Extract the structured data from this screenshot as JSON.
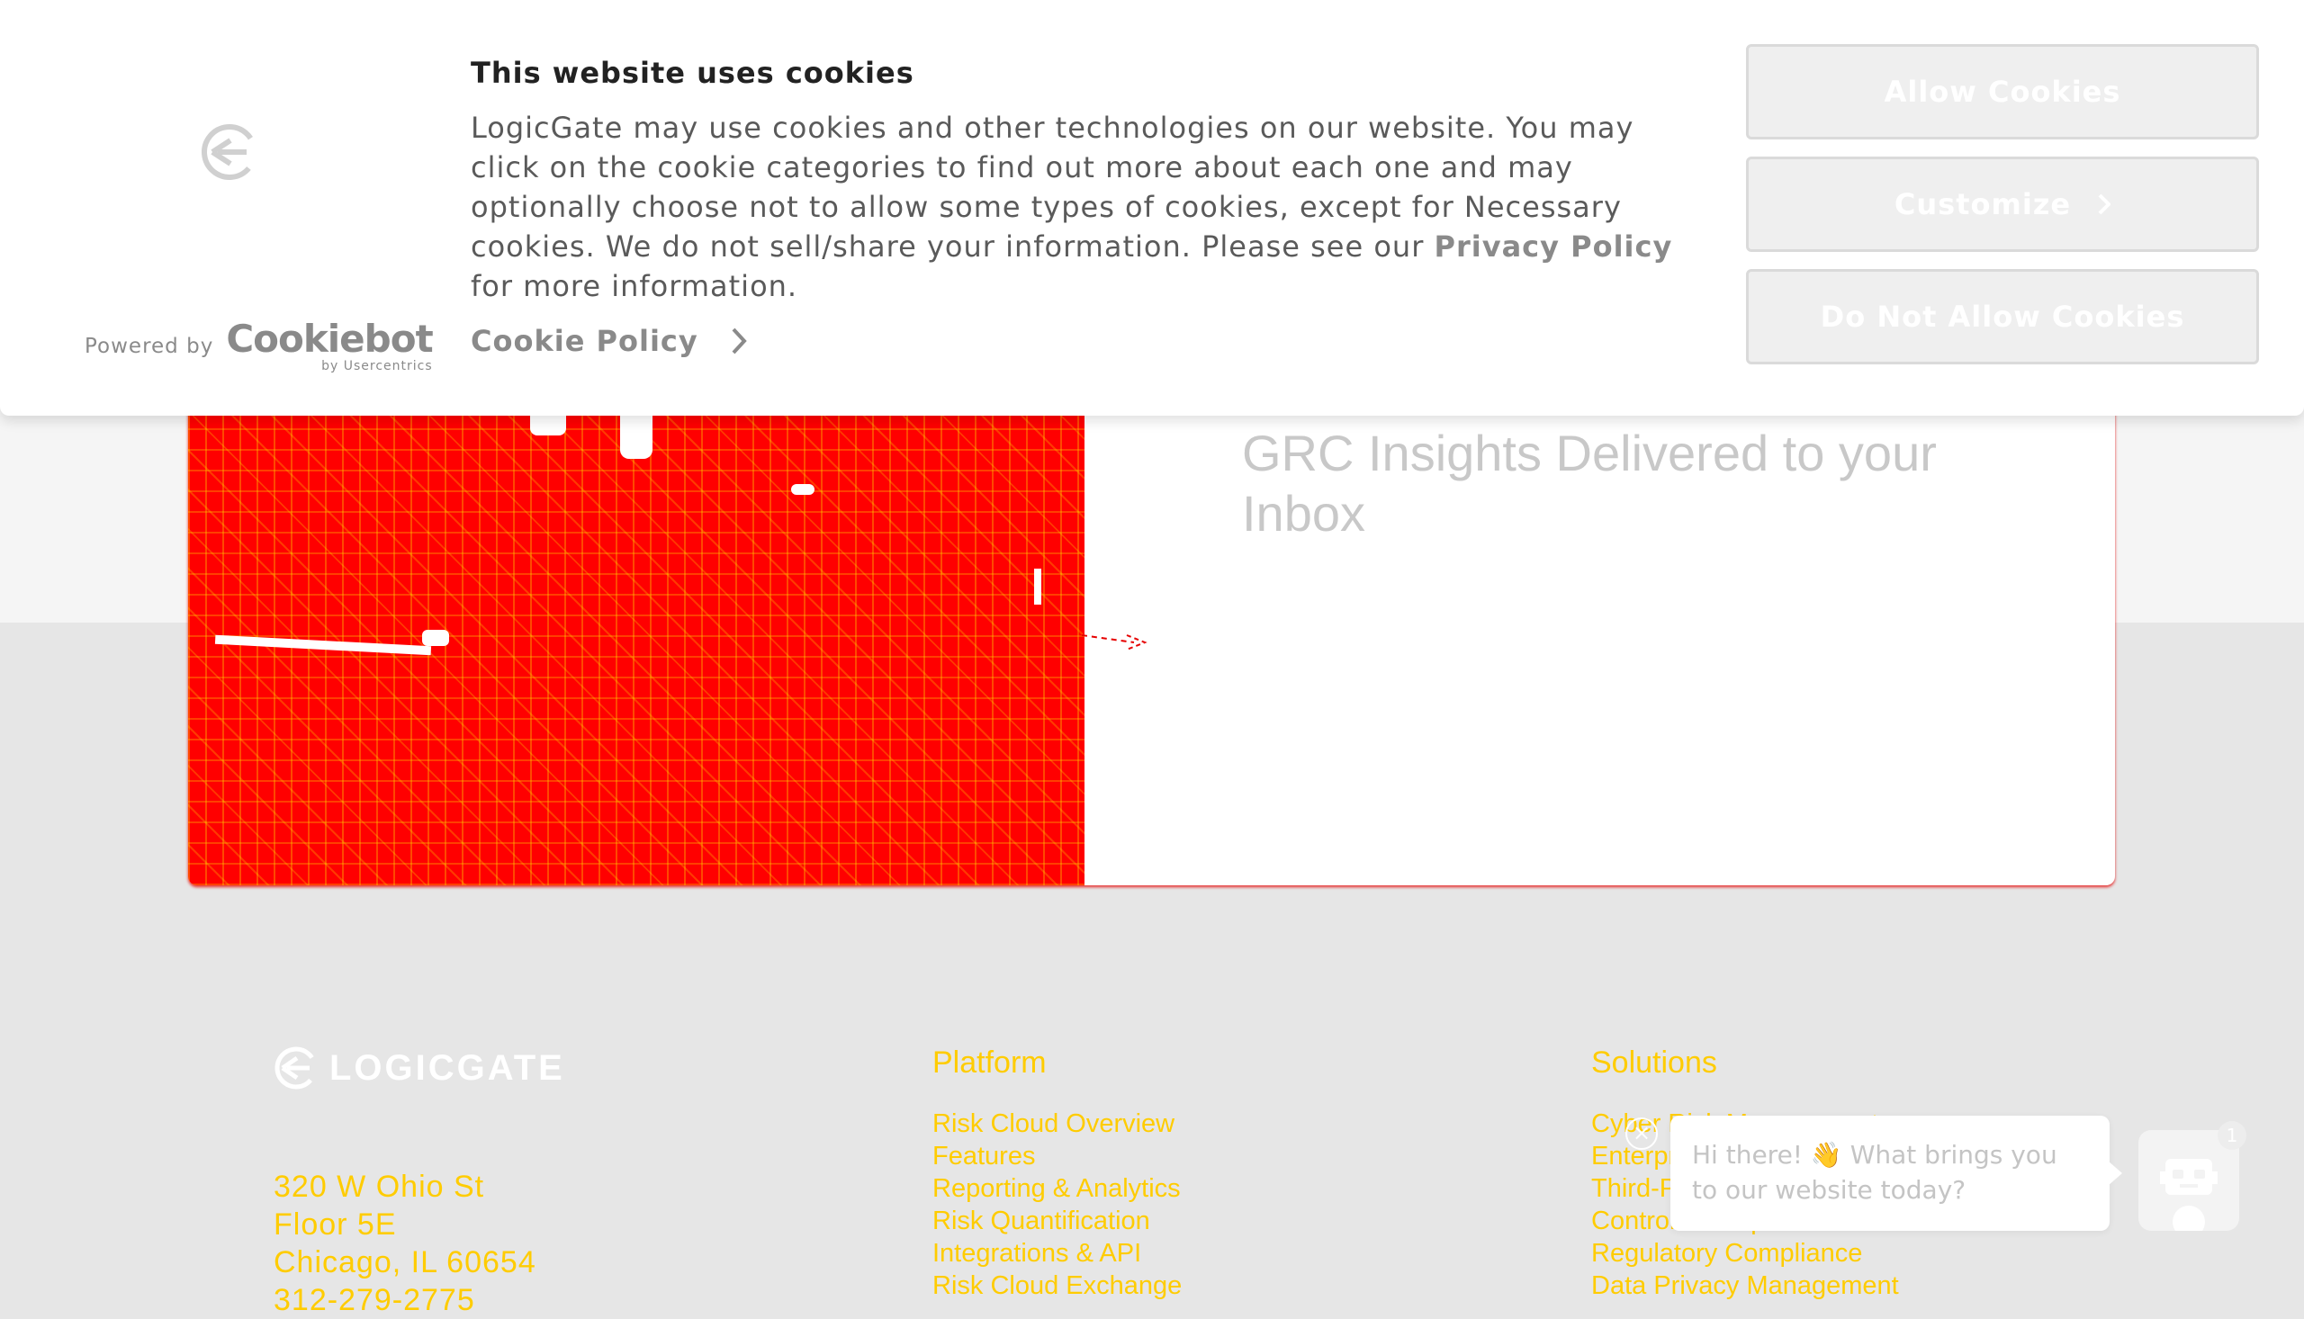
{
  "cookie_banner": {
    "heading": "This website uses cookies",
    "body_pre": "LogicGate may use cookies and other technologies on our website. You may click on the cookie categories to find out more about each one and may optionally choose not to allow some types of cookies, except for Necessary cookies.  We do not sell/share your information. Please see our ",
    "privacy_link": "Privacy Policy",
    "body_post": " for more information.",
    "cookie_policy_link": "Cookie Policy",
    "powered_by": "Powered by",
    "cookiebot_name": "Cookiebot",
    "cookiebot_sub": "by Usercentrics",
    "allow_label": "Allow Cookies",
    "customize_label": "Customize",
    "deny_label": "Do Not Allow Cookies"
  },
  "hero": {
    "title": "GRC Insights Delivered to your Inbox"
  },
  "footer": {
    "logo_text": "LOGICGATE",
    "address": [
      "320 W Ohio St",
      "Floor 5E",
      "Chicago, IL 60654",
      "312-279-2775"
    ],
    "platform": {
      "heading": "Platform",
      "links": [
        "Risk Cloud Overview",
        "Features",
        "Reporting & Analytics",
        "Risk Quantification",
        "Integrations & API",
        "Risk Cloud Exchange"
      ]
    },
    "solutions": {
      "heading": "Solutions",
      "links": [
        "Cyber Risk Management",
        "Enterprise Risk Management",
        "Third-Party Risk Management",
        "Controls Compliance",
        "Regulatory Compliance",
        "Data Privacy Management"
      ]
    }
  },
  "chat": {
    "message": "Hi there! 👋 What brings you to our website today?",
    "badge_count": "1"
  },
  "colors": {
    "accent_yellow": "#ffcc00",
    "image_red": "#ff0000"
  }
}
